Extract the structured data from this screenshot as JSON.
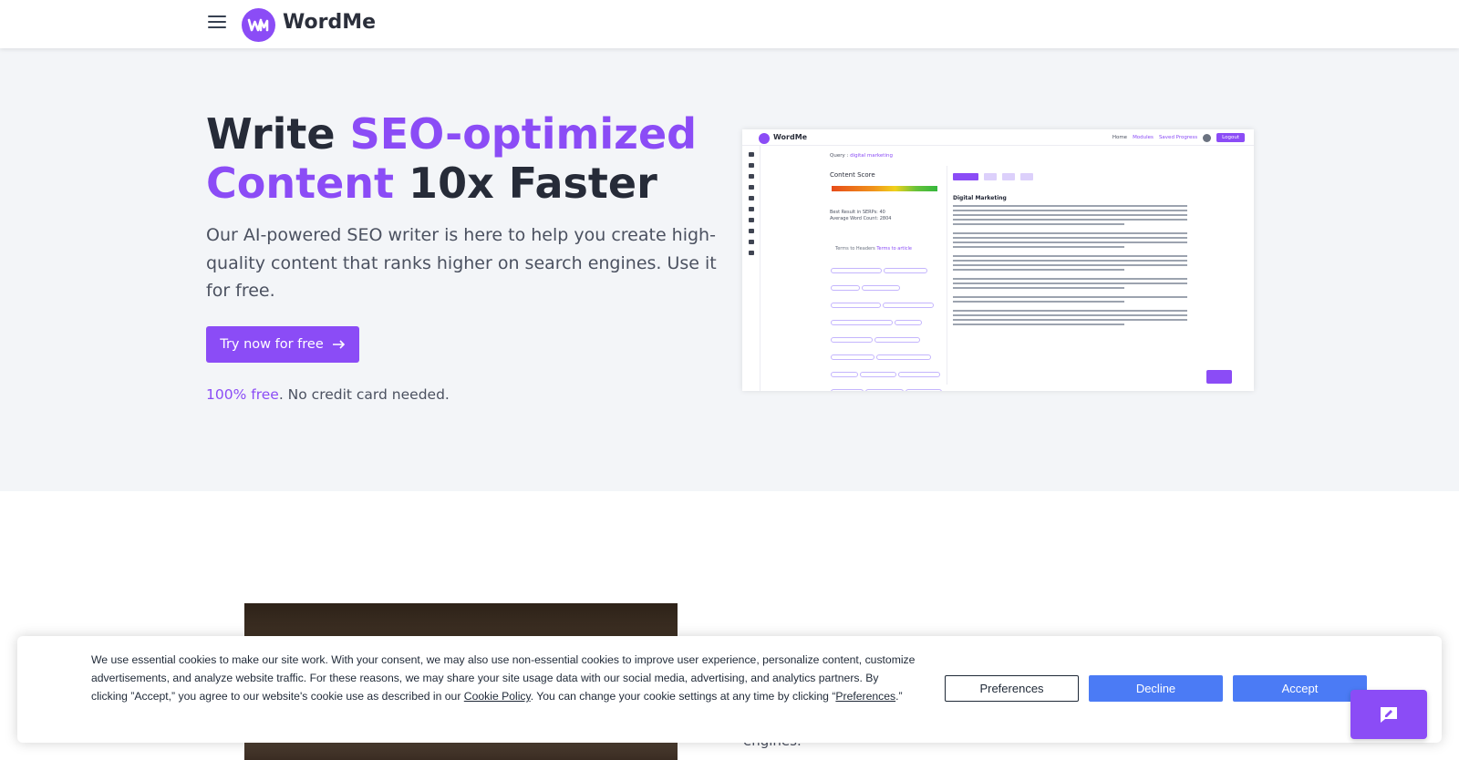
{
  "nav": {
    "brand": "WordMe"
  },
  "hero": {
    "headline_part1": "Write ",
    "headline_accent1": "SEO-optimized",
    "headline_accent2": "Content",
    "headline_part2": " 10x Faster",
    "subtext": "Our AI-powered SEO writer is here to help you create high-quality content that ranks higher on search engines. Use it for free.",
    "cta_label": "Try now for free",
    "free_accent": "100% free",
    "free_rest": ". No credit card needed."
  },
  "preview": {
    "brand": "WordMe",
    "nav": [
      "Home",
      "Modules",
      "Saved Progress"
    ],
    "logout": "Logout",
    "query_label": "Query :",
    "query_value": "digital marketing",
    "score_title": "Content Score",
    "serp_label": "Best Result in SERPs:",
    "serp_value": "40",
    "word_label": "Average Word Count:",
    "word_value": "2804",
    "tabs": [
      "Terms to Headers",
      "Terms to article"
    ],
    "doc_title": "Digital Marketing"
  },
  "section2": {
    "engines_text": "engines."
  },
  "cookie": {
    "text_before": "We use essential cookies to make our site work. With your consent, we may also use non-essential cookies to improve user experience, personalize content, customize advertisements, and analyze website traffic. For these reasons, we may share your site usage data with our social media, advertising, and analytics partners. By clicking ”Accept,” you agree to our website's cookie use as described in our ",
    "policy_link": "Cookie Policy",
    "text_middle": ". You can change your cookie settings at any time by clicking “",
    "preferences_link": "Preferences",
    "text_after": ".”",
    "preferences_button": "Preferences",
    "decline_button": "Decline",
    "accept_button": "Accept"
  },
  "colors": {
    "brand": "#8b4cf6",
    "cookie_button": "#4b7bf5",
    "hero_bg": "#f3f5f8"
  },
  "icons": {
    "menu": "hamburger-icon",
    "arrow": "arrow-right-icon",
    "chat": "chat-icon"
  }
}
